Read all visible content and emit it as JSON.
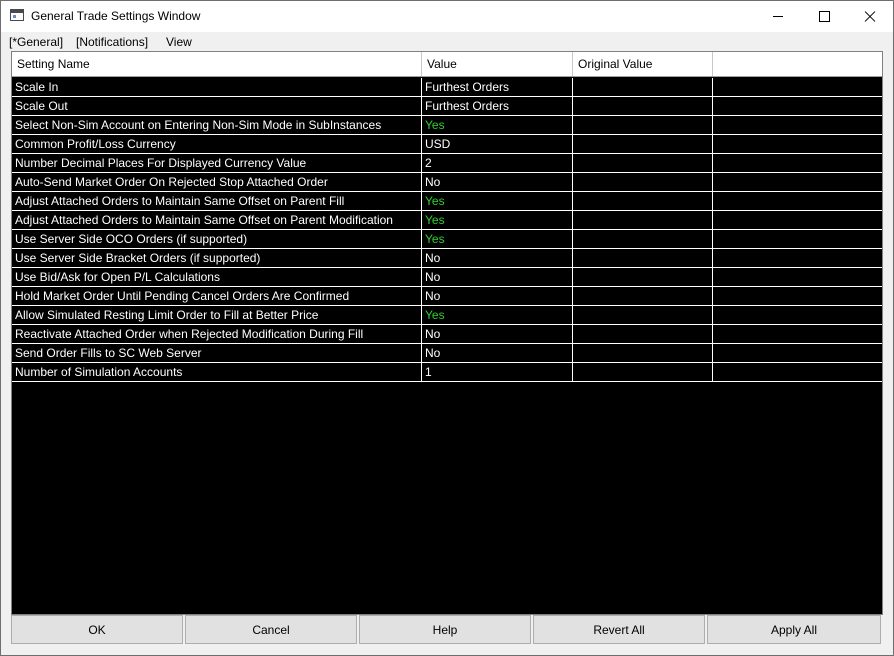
{
  "window": {
    "title": "General Trade Settings Window",
    "icon": "app-window-icon"
  },
  "menu": {
    "items": [
      "[*General]",
      "[Notifications]",
      "View"
    ]
  },
  "table": {
    "columns": [
      "Setting Name",
      "Value",
      "Original Value",
      ""
    ],
    "rows": [
      {
        "name": "Scale In",
        "value": "Furthest Orders",
        "original": ""
      },
      {
        "name": "Scale Out",
        "value": "Furthest Orders",
        "original": ""
      },
      {
        "name": "Select Non-Sim Account on Entering Non-Sim Mode in SubInstances",
        "value": "Yes",
        "original": ""
      },
      {
        "name": "Common Profit/Loss Currency",
        "value": "USD",
        "original": ""
      },
      {
        "name": "Number Decimal Places For Displayed Currency Value",
        "value": "2",
        "original": ""
      },
      {
        "name": "Auto-Send Market Order On Rejected Stop Attached Order",
        "value": "No",
        "original": ""
      },
      {
        "name": "Adjust Attached Orders to Maintain Same Offset on Parent Fill",
        "value": "Yes",
        "original": ""
      },
      {
        "name": "Adjust Attached Orders to Maintain Same Offset on Parent Modification",
        "value": "Yes",
        "original": ""
      },
      {
        "name": "Use Server Side OCO Orders (if supported)",
        "value": "Yes",
        "original": ""
      },
      {
        "name": "Use Server Side Bracket Orders (if supported)",
        "value": "No",
        "original": ""
      },
      {
        "name": "Use Bid/Ask for Open P/L Calculations",
        "value": "No",
        "original": ""
      },
      {
        "name": "Hold Market Order Until Pending Cancel Orders Are Confirmed",
        "value": "No",
        "original": ""
      },
      {
        "name": "Allow Simulated Resting Limit Order to Fill at Better Price",
        "value": "Yes",
        "original": ""
      },
      {
        "name": "Reactivate Attached Order when Rejected Modification During Fill",
        "value": "No",
        "original": ""
      },
      {
        "name": "Send Order Fills to SC Web Server",
        "value": "No",
        "original": ""
      },
      {
        "name": "Number of Simulation Accounts",
        "value": "1",
        "original": ""
      }
    ]
  },
  "buttons": {
    "ok": "OK",
    "cancel": "Cancel",
    "help": "Help",
    "revert_all": "Revert All",
    "apply_all": "Apply All"
  },
  "colors": {
    "grid_background": "#000000",
    "grid_text": "#ffffff",
    "yes_value": "#2fd12f"
  }
}
